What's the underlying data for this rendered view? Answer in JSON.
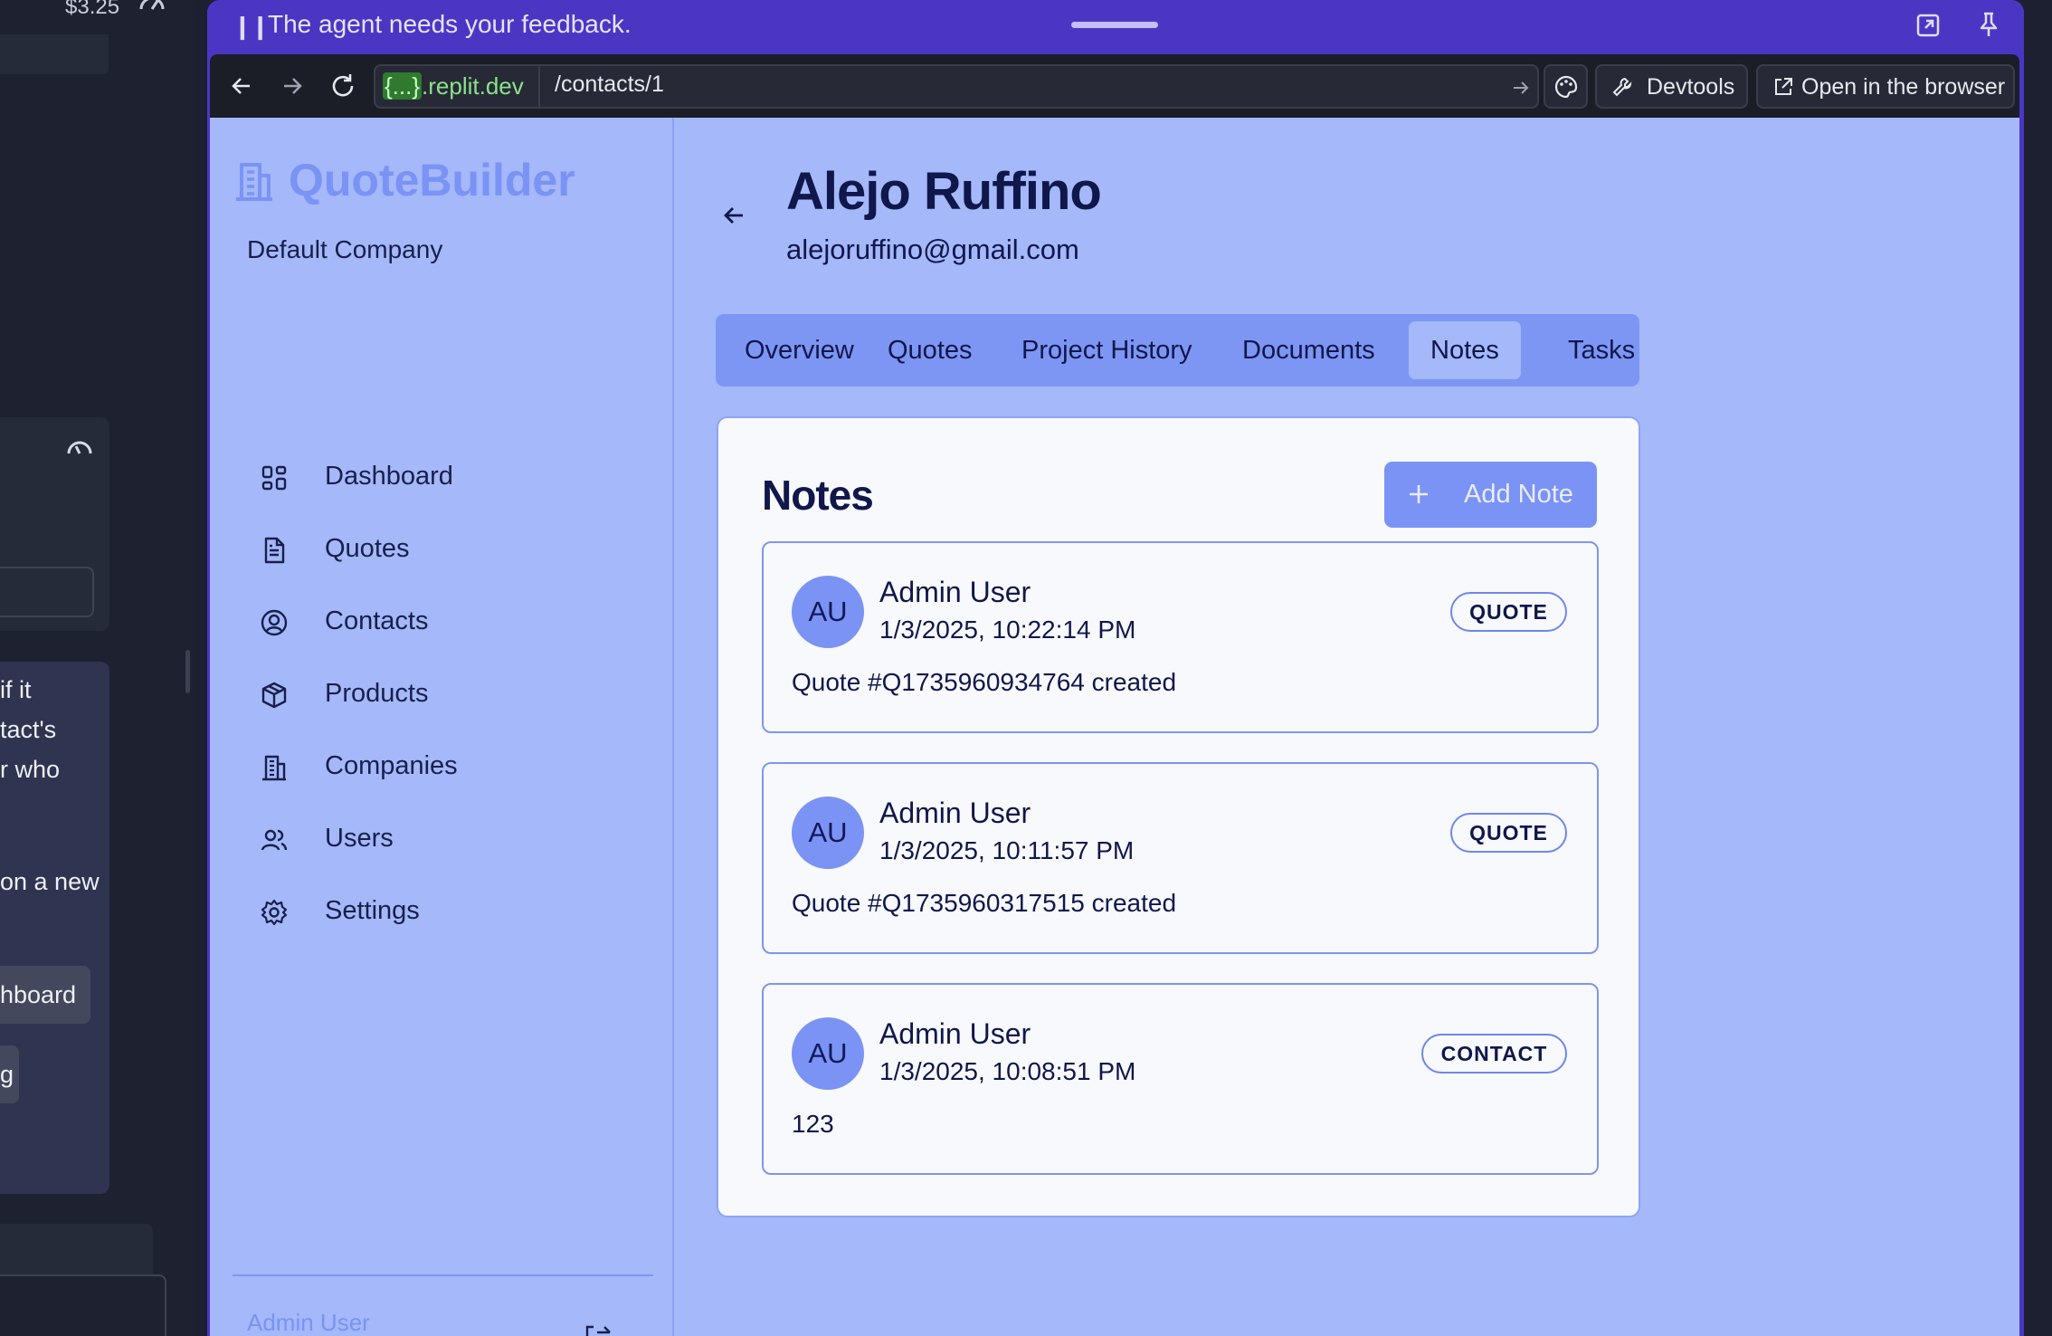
{
  "chat": {
    "cost": "$3.25",
    "lines": [
      "if it",
      "tact's",
      "r who",
      "on a new"
    ],
    "buttons": [
      "hboard",
      "g"
    ]
  },
  "preview": {
    "feedback_banner": "The agent needs your feedback.",
    "url_domain_prefix": "{...}",
    "url_domain_suffix": ".replit.dev",
    "url_path": "/contacts/1",
    "devtools_label": "Devtools",
    "open_browser_label": "Open in the browser"
  },
  "app": {
    "brand": "QuoteBuilder",
    "company": "Default Company",
    "nav": [
      {
        "label": "Dashboard",
        "icon": "dashboard-icon"
      },
      {
        "label": "Quotes",
        "icon": "file-icon"
      },
      {
        "label": "Contacts",
        "icon": "user-circle-icon"
      },
      {
        "label": "Products",
        "icon": "box-icon"
      },
      {
        "label": "Companies",
        "icon": "building-icon"
      },
      {
        "label": "Users",
        "icon": "users-icon"
      },
      {
        "label": "Settings",
        "icon": "gear-icon"
      }
    ],
    "footer_user": "Admin User"
  },
  "contact": {
    "name": "Alejo Ruffino",
    "email": "alejoruffino@gmail.com"
  },
  "tabs": [
    {
      "label": "Overview",
      "active": false
    },
    {
      "label": "Quotes",
      "active": false
    },
    {
      "label": "Project History",
      "active": false
    },
    {
      "label": "Documents",
      "active": false
    },
    {
      "label": "Notes",
      "active": true
    },
    {
      "label": "Tasks",
      "active": false
    }
  ],
  "notes_panel": {
    "title": "Notes",
    "add_label": "Add Note",
    "notes": [
      {
        "initials": "AU",
        "author": "Admin User",
        "timestamp": "1/3/2025, 10:22:14 PM",
        "tag": "QUOTE",
        "body": "Quote #Q1735960934764 created"
      },
      {
        "initials": "AU",
        "author": "Admin User",
        "timestamp": "1/3/2025, 10:11:57 PM",
        "tag": "QUOTE",
        "body": "Quote #Q1735960317515 created"
      },
      {
        "initials": "AU",
        "author": "Admin User",
        "timestamp": "1/3/2025, 10:08:51 PM",
        "tag": "CONTACT",
        "body": "123"
      }
    ]
  }
}
